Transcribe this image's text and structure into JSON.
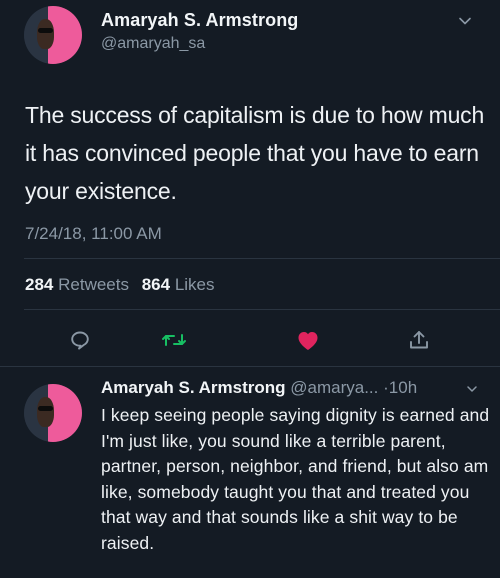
{
  "main_tweet": {
    "author_name": "Amaryah S. Armstrong",
    "author_handle": "@amaryah_sa",
    "text": "The success of capitalism is due to how much it has convinced people that you have to earn your existence.",
    "timestamp": "7/24/18, 11:00 AM",
    "retweet_count": "284",
    "retweet_label": "Retweets",
    "like_count": "864",
    "like_label": "Likes"
  },
  "actions": {
    "reply_icon": "reply-icon",
    "retweet_icon": "retweet-icon",
    "like_icon": "heart-icon",
    "share_icon": "share-icon",
    "like_color": "#e0245e",
    "retweet_color": "#17bf63"
  },
  "reply_tweet": {
    "author_name": "Amaryah S. Armstrong",
    "author_handle_truncated": "@amarya...",
    "separator": "·",
    "time_ago": "10h",
    "text": "I keep seeing people saying dignity is earned and I'm just like, you sound like a terrible parent, partner, person, neighbor, and friend, but also am like, somebody taught you that and treated you that way and that sounds like a shit way to be raised."
  },
  "colors": {
    "background": "#141b24",
    "text_primary": "#eef1f4",
    "text_secondary": "#8b98a5",
    "avatar_accent": "#ee5b9b"
  }
}
